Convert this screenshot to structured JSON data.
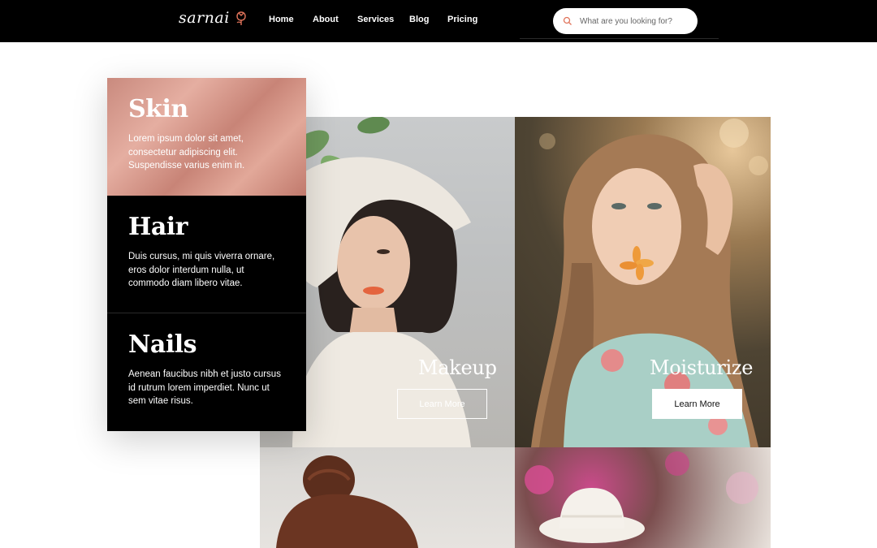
{
  "header": {
    "logo_text": "sarnai",
    "logo_icon": "flower-icon",
    "nav": [
      {
        "label": "Home"
      },
      {
        "label": "About"
      },
      {
        "label": "Services"
      },
      {
        "label": "Blog"
      },
      {
        "label": "Pricing"
      }
    ],
    "search": {
      "placeholder": "What are you looking for?",
      "icon": "search-icon"
    }
  },
  "services": [
    {
      "title": "Skin",
      "description": "Lorem ipsum dolor sit amet, consectetur adipiscing elit. Suspendisse varius enim in."
    },
    {
      "title": "Hair",
      "description": "Duis cursus, mi quis viverra ornare, eros dolor interdum nulla, ut commodo diam libero vitae."
    },
    {
      "title": "Nails",
      "description": "Aenean faucibus nibh et justo cursus id rutrum lorem imperdiet. Nunc ut sem vitae risus."
    }
  ],
  "gallery": [
    {
      "title": "Makeup",
      "button": "Learn More"
    },
    {
      "title": "Moisturize",
      "button": "Learn More"
    }
  ],
  "colors": {
    "header_bg": "#000000",
    "skin_accent": "#d89a8c",
    "search_icon": "#e0735a"
  }
}
